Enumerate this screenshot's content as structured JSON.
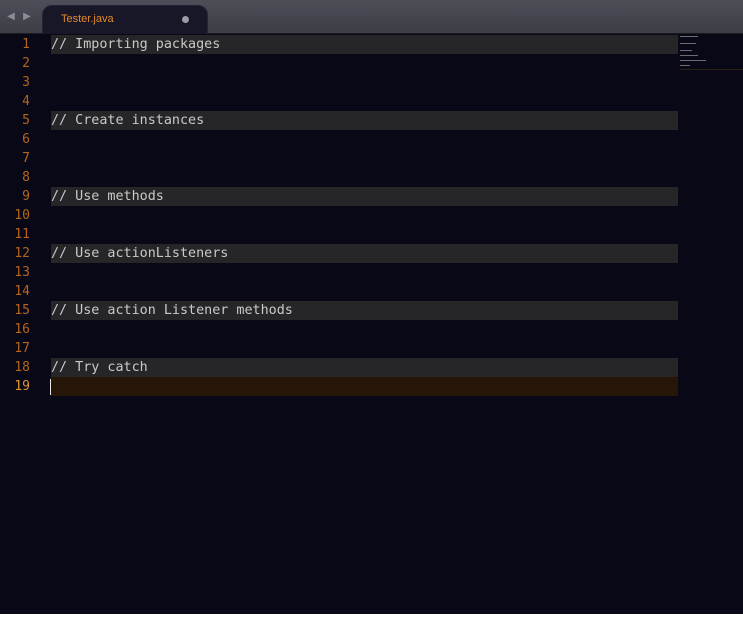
{
  "tabs": [
    {
      "title": "Tester.java",
      "modified": true
    }
  ],
  "editor": {
    "lines": [
      {
        "num": "1",
        "text": "// Importing packages",
        "comment": true
      },
      {
        "num": "2",
        "text": ""
      },
      {
        "num": "3",
        "text": ""
      },
      {
        "num": "4",
        "text": ""
      },
      {
        "num": "5",
        "text": "// Create instances",
        "comment": true
      },
      {
        "num": "6",
        "text": ""
      },
      {
        "num": "7",
        "text": ""
      },
      {
        "num": "8",
        "text": ""
      },
      {
        "num": "9",
        "text": "// Use methods",
        "comment": true
      },
      {
        "num": "10",
        "text": ""
      },
      {
        "num": "11",
        "text": ""
      },
      {
        "num": "12",
        "text": "// Use actionListeners",
        "comment": true
      },
      {
        "num": "13",
        "text": ""
      },
      {
        "num": "14",
        "text": ""
      },
      {
        "num": "15",
        "text": "// Use action Listener methods",
        "comment": true
      },
      {
        "num": "16",
        "text": ""
      },
      {
        "num": "17",
        "text": ""
      },
      {
        "num": "18",
        "text": "// Try catch",
        "comment": true
      },
      {
        "num": "19",
        "text": "",
        "current": true
      }
    ]
  },
  "colors": {
    "background": "#080816",
    "line_number": "#b5651d",
    "current_line": "#251607",
    "comment_highlight": "#262628",
    "tab_title": "#e28a2b"
  },
  "icons": {
    "nav_back": "triangle-left-icon",
    "nav_forward": "triangle-right-icon",
    "modified": "dot-icon"
  }
}
